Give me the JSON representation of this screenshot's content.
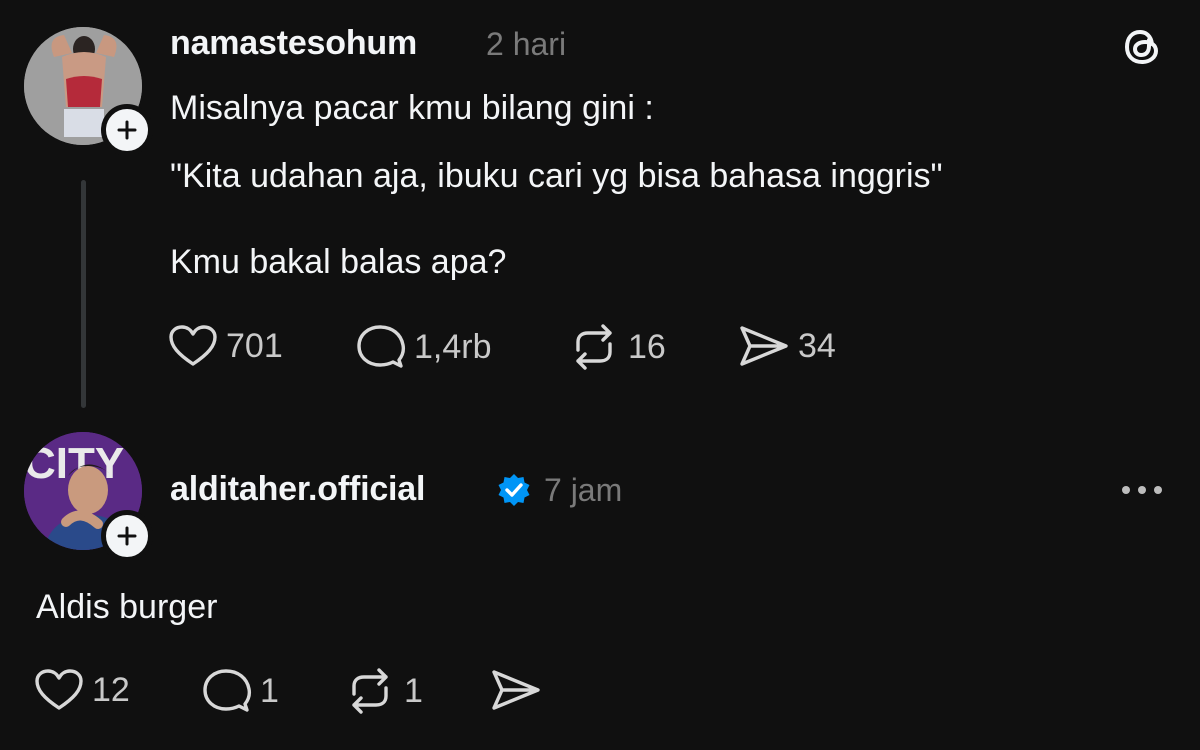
{
  "post": {
    "username": "namastesohum",
    "time": "2 hari",
    "lines": [
      "Misalnya pacar kmu bilang gini :",
      "\"Kita udahan aja, ibuku cari yg bisa bahasa inggris\"",
      "Kmu bakal balas apa?"
    ],
    "actions": {
      "likes": "701",
      "replies": "1,4rb",
      "reposts": "16",
      "shares": "34"
    }
  },
  "reply": {
    "username": "alditaher.official",
    "verified": true,
    "time": "7 jam",
    "text": "Aldis burger",
    "avatar_text": "CITY",
    "actions": {
      "likes": "12",
      "replies": "1",
      "reposts": "1"
    }
  },
  "icons": {
    "app_logo": "threads-logo-icon",
    "more": "more-horizontal-icon",
    "like": "heart-icon",
    "reply": "comment-icon",
    "repost": "repost-icon",
    "share": "send-icon",
    "follow": "plus-icon",
    "verified": "verified-badge-icon"
  },
  "colors": {
    "background": "#101010",
    "text": "#f3f5f7",
    "secondary": "#7a7a7a",
    "verified": "#0095f6"
  }
}
